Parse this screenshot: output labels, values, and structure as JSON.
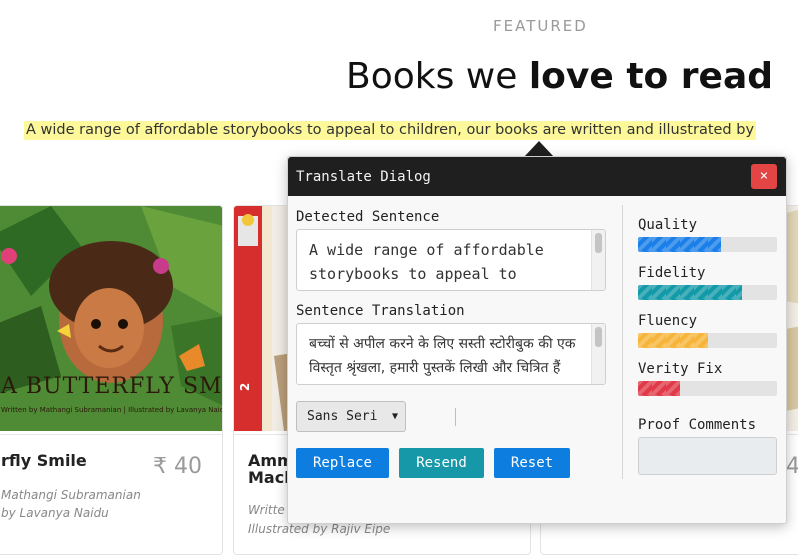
{
  "hero": {
    "eyebrow": "FEATURED",
    "title_light": "Books we ",
    "title_bold": "love to read",
    "subtitle": "A wide range of affordable storybooks to appeal to children, our books are written and illustrated by"
  },
  "books": [
    {
      "cover_title": "A BUTTERFLY SMILE",
      "cover_credit": "Written by Mathangi Subramanian  |  Illustrated by Lavanya Naidu",
      "title": "rfly Smile",
      "price": "₹ 40",
      "byline_1": "Mathangi Subramanian",
      "byline_2": "by Lavanya Naidu"
    },
    {
      "cover_badge": "2",
      "title_line1": "Amm",
      "title_line2": "Mach",
      "byline_1": "Writte",
      "byline_2": "Illustrated by Rajiv Eipe"
    },
    {
      "price": "4"
    }
  ],
  "dialog": {
    "title": "Translate Dialog",
    "close_label": "×",
    "detected_label": "Detected Sentence",
    "detected_text": "A wide range of affordable storybooks to appeal to children,",
    "translation_label": "Sentence Translation",
    "translation_text": "बच्चों से अपील करने के लिए सस्ती स्टोरीबुक की एक विस्तृत श्रृंखला, हमारी पुस्तकें लिखी और चित्रित हैं",
    "font_select": "Sans Seri",
    "buttons": {
      "replace": "Replace",
      "resend": "Resend",
      "reset": "Reset"
    },
    "metrics": [
      {
        "label": "Quality",
        "value": 0.6,
        "color": "#1a7fe8"
      },
      {
        "label": "Fidelity",
        "value": 0.75,
        "color": "#139aa8"
      },
      {
        "label": "Fluency",
        "value": 0.5,
        "color": "#f6b53a"
      },
      {
        "label": "Verity Fix",
        "value": 0.3,
        "color": "#e03a48"
      }
    ],
    "comments_label": "Proof Comments",
    "comments_value": ""
  }
}
